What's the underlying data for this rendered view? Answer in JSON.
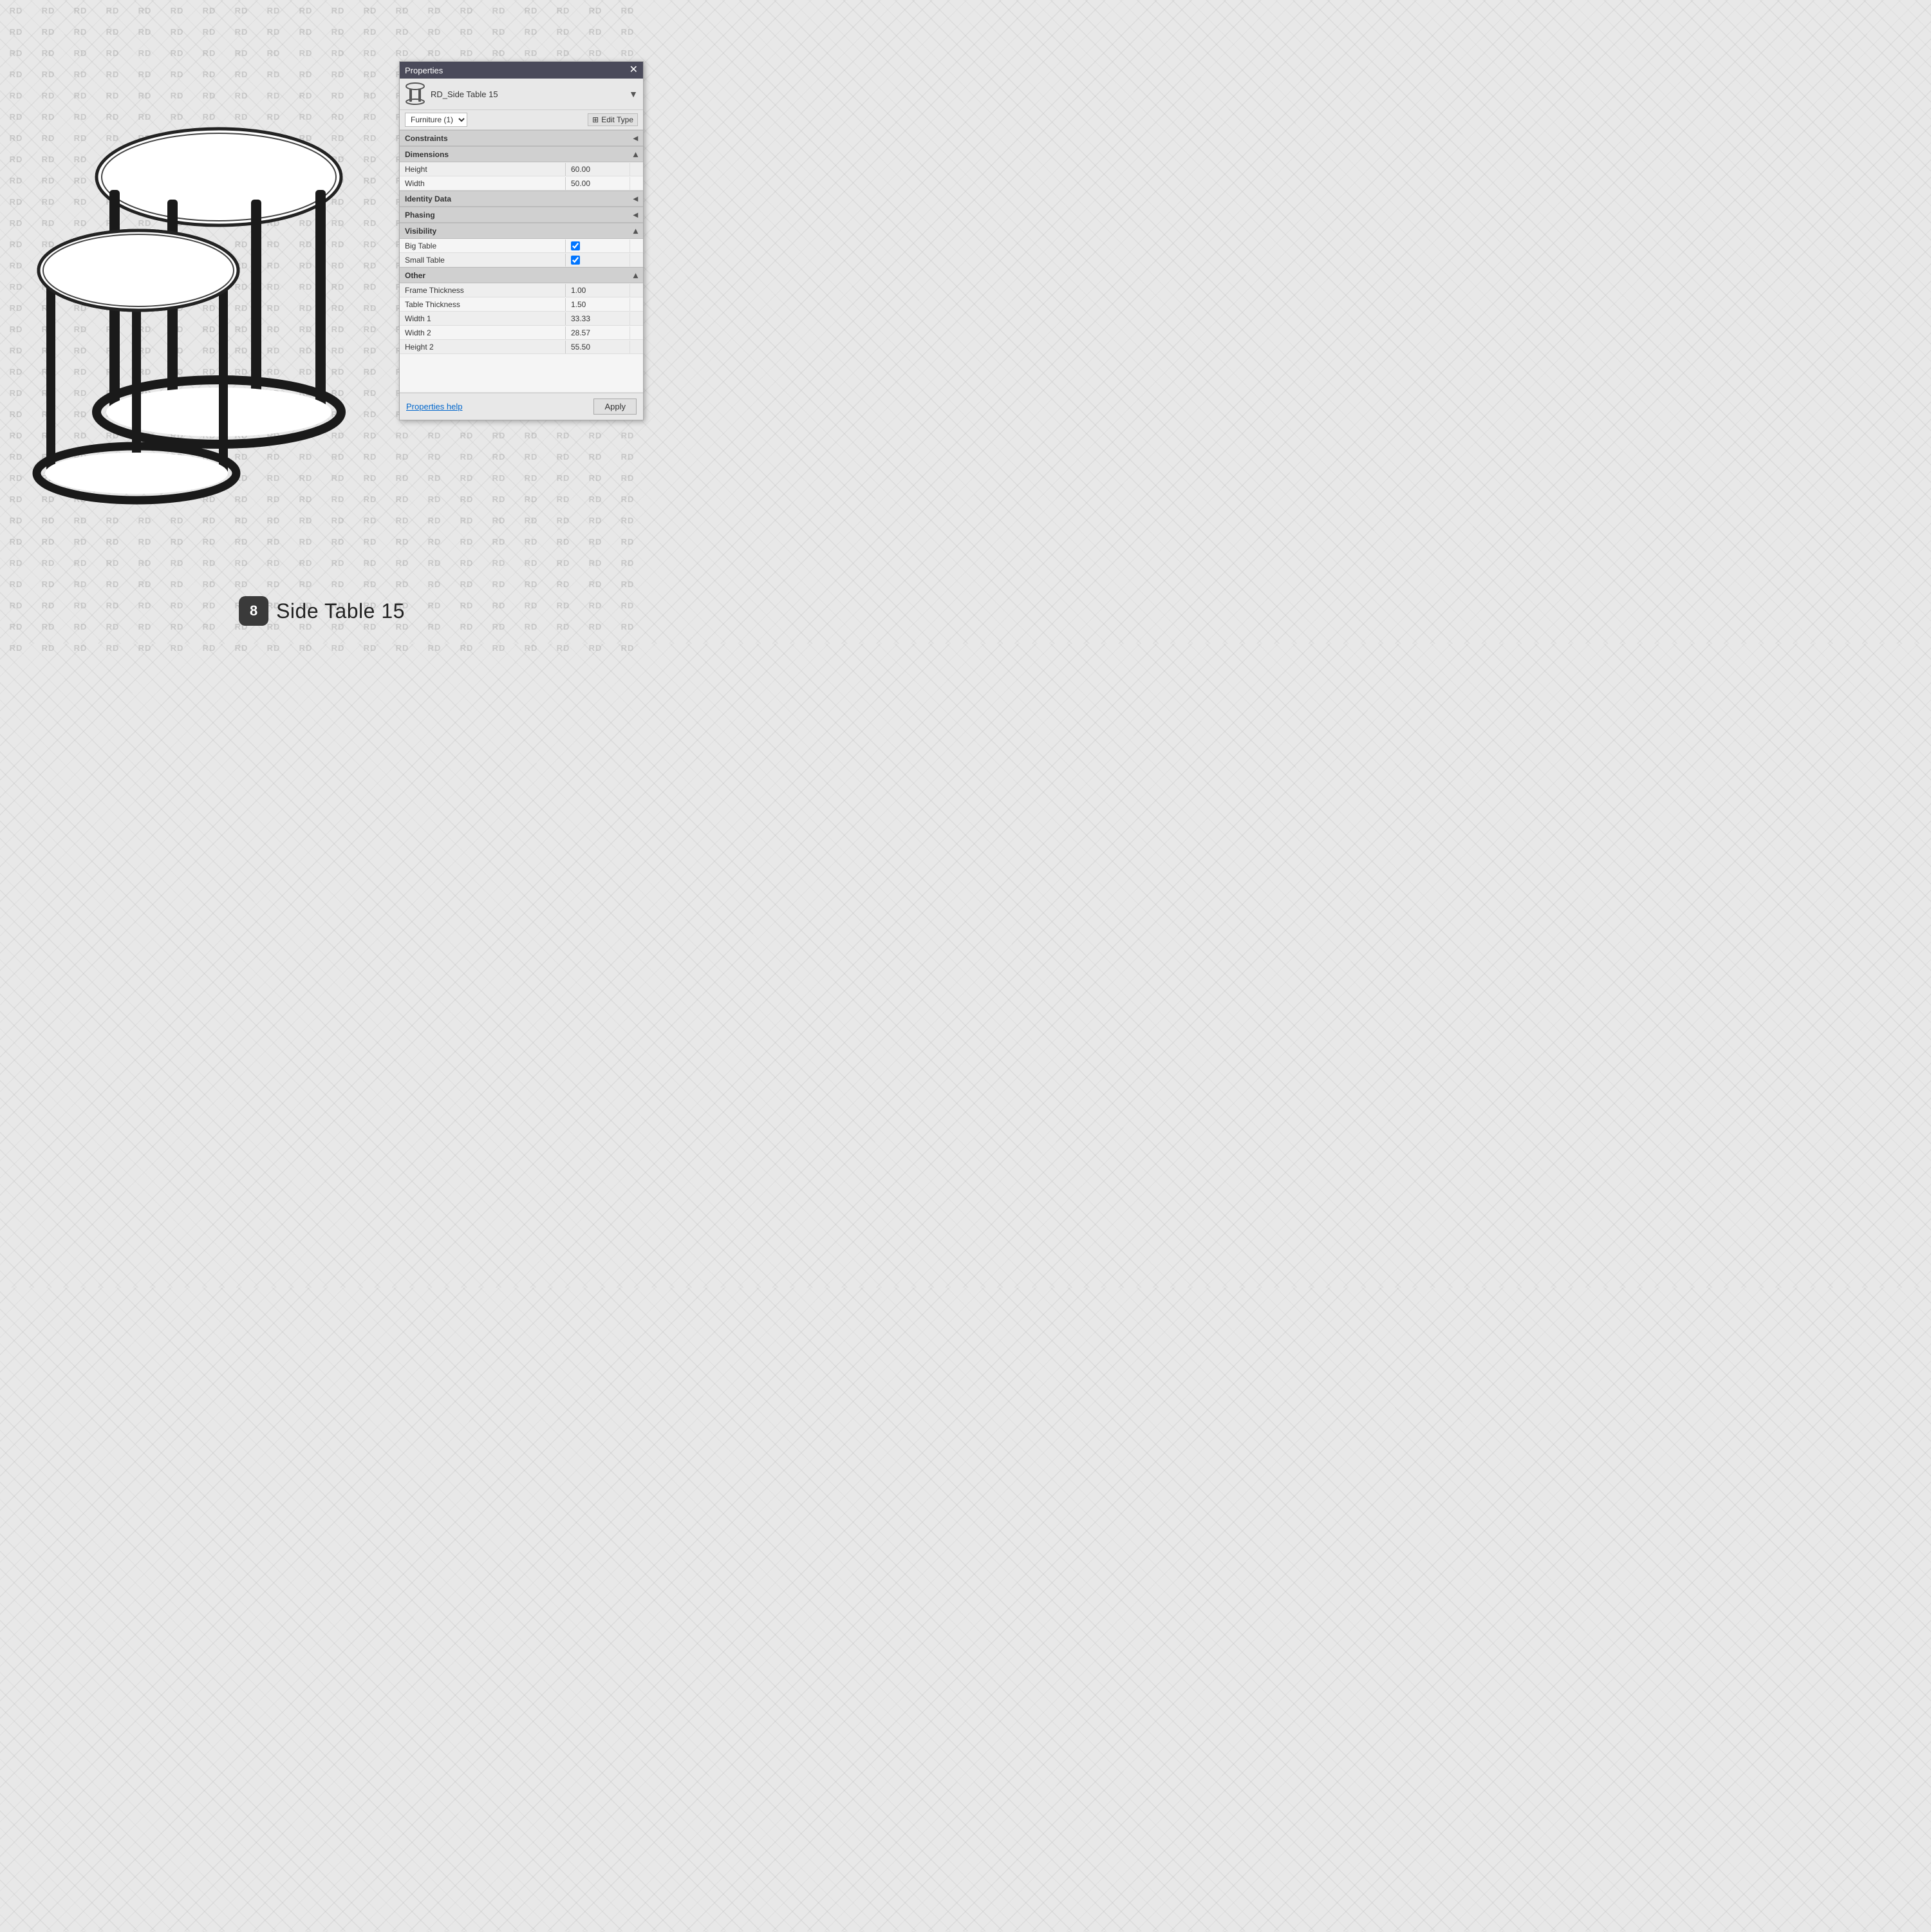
{
  "watermark": {
    "text": "RD",
    "cols": 20,
    "rows": 31
  },
  "panel": {
    "title": "Properties",
    "close_label": "✕",
    "item_name": "RD_Side Table 15",
    "type_category": "Furniture (1)",
    "edit_type_label": "Edit Type",
    "sections": {
      "constraints": {
        "label": "Constraints",
        "collapse_icon": "◂"
      },
      "dimensions": {
        "label": "Dimensions",
        "collapse_icon": "▴",
        "properties": [
          {
            "label": "Height",
            "value": "60.00"
          },
          {
            "label": "Width",
            "value": "50.00"
          }
        ]
      },
      "identity_data": {
        "label": "Identity Data",
        "collapse_icon": "◂"
      },
      "phasing": {
        "label": "Phasing",
        "collapse_icon": "◂"
      },
      "visibility": {
        "label": "Visibility",
        "collapse_icon": "▴",
        "properties": [
          {
            "label": "Big Table",
            "value": "checked"
          },
          {
            "label": "Small Table",
            "value": "checked"
          }
        ]
      },
      "other": {
        "label": "Other",
        "collapse_icon": "▴",
        "properties": [
          {
            "label": "Frame Thickness",
            "value": "1.00"
          },
          {
            "label": "Table Thickness",
            "value": "1.50"
          },
          {
            "label": "Width 1",
            "value": "33.33"
          },
          {
            "label": "Width 2",
            "value": "28.57"
          },
          {
            "label": "Height 2",
            "value": "55.50"
          }
        ]
      }
    },
    "footer": {
      "help_link": "Properties help",
      "apply_button": "Apply"
    }
  },
  "label": {
    "badge": "8",
    "text": "Side Table 15"
  }
}
